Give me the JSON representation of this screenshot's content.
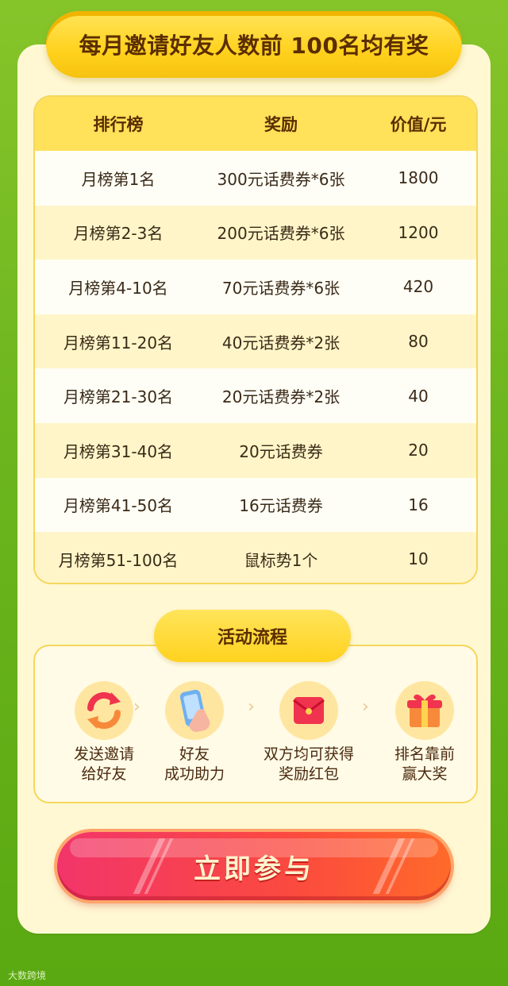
{
  "header": {
    "title": "每月邀请好友人数前 100名均有奖"
  },
  "table": {
    "headers": [
      "排行榜",
      "奖励",
      "价值/元"
    ],
    "rows": [
      [
        "月榜第1名",
        "300元话费券*6张",
        "1800"
      ],
      [
        "月榜第2-3名",
        "200元话费券*6张",
        "1200"
      ],
      [
        "月榜第4-10名",
        "70元话费券*6张",
        "420"
      ],
      [
        "月榜第11-20名",
        "40元话费券*2张",
        "80"
      ],
      [
        "月榜第21-30名",
        "20元话费券*2张",
        "40"
      ],
      [
        "月榜第31-40名",
        "20元话费券",
        "20"
      ],
      [
        "月榜第41-50名",
        "16元话费券",
        "16"
      ],
      [
        "月榜第51-100名",
        "鼠标势1个",
        "10"
      ]
    ]
  },
  "flow": {
    "title": "活动流程",
    "steps": [
      {
        "icon": "refresh-arrows-icon",
        "label1": "发送邀请",
        "label2": "给好友"
      },
      {
        "icon": "phone-tap-icon",
        "label1": "好友",
        "label2": "成功助力"
      },
      {
        "icon": "red-envelope-icon",
        "label1": "双方均可获得",
        "label2": "奖励红包"
      },
      {
        "icon": "gift-box-icon",
        "label1": "排名靠前",
        "label2": "赢大奖"
      }
    ],
    "arrow": "›"
  },
  "cta": {
    "label": "立即参与"
  },
  "watermark": "大数跨境",
  "colors": {
    "background": "#6cb51e",
    "accent_yellow": "#ffd21e",
    "cta_red": "#fb4a3e"
  }
}
